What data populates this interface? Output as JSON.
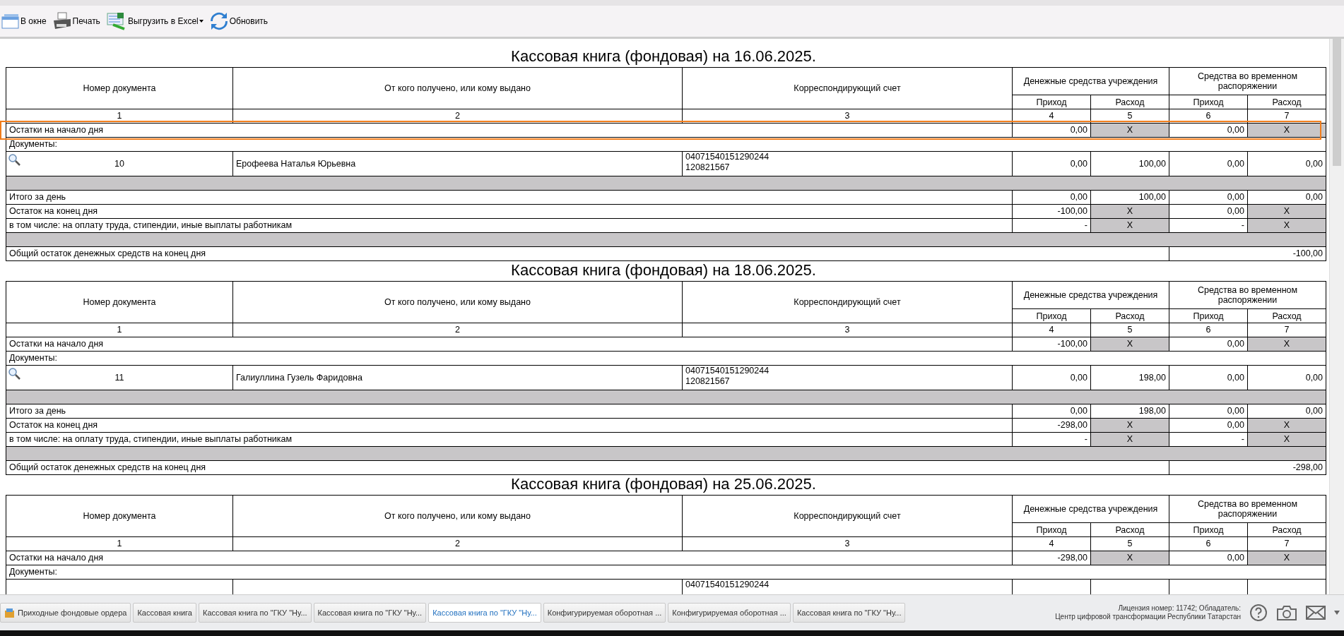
{
  "toolbar": {
    "buttons": [
      {
        "kind": "window",
        "label": "В окне"
      },
      {
        "kind": "print",
        "label": "Печать"
      },
      {
        "kind": "excel",
        "label": "Выгрузить в Excel",
        "dropdown": true
      },
      {
        "kind": "refresh",
        "label": "Обновить"
      }
    ]
  },
  "books": [
    {
      "title": "Кассовая книга (фондовая) на 16.06.2025.",
      "header": {
        "doc_number": "Номер документа",
        "counterparty": "От кого получено, или кому выдано",
        "account": "Корреспондирующий счет",
        "group_1": "Денежные средства учреждения",
        "group_2": "Средства во временном распоряжении",
        "income": "Приход",
        "expense": "Расход",
        "income_2": "Приход",
        "expense_2": "Расход",
        "column_numbers": [
          "1",
          "2",
          "3",
          "4",
          "5",
          "6",
          "7"
        ]
      },
      "opening": {
        "label": "Остатки на начало дня",
        "highlighted": true,
        "cells": [
          {
            "text": "0,00",
            "blocked": false
          },
          {
            "text": "X",
            "blocked": true
          },
          {
            "text": "0,00",
            "blocked": false
          },
          {
            "text": "X",
            "blocked": true
          }
        ]
      },
      "documents_label": "Документы:",
      "documents": [
        {
          "number": "10",
          "name": "Ерофеева Наталья Юрьевна",
          "account": [
            "04071540151290244",
            "120821567"
          ],
          "cells": [
            "0,00",
            "100,00",
            "0,00",
            "0,00"
          ]
        }
      ],
      "summary": [
        {
          "label": "Итого за день",
          "cells": [
            {
              "text": "0,00",
              "blocked": false
            },
            {
              "text": "100,00",
              "blocked": false
            },
            {
              "text": "0,00",
              "blocked": false
            },
            {
              "text": "0,00",
              "blocked": false
            }
          ]
        },
        {
          "label": "Остаток на конец дня",
          "cells": [
            {
              "text": "-100,00",
              "blocked": false
            },
            {
              "text": "X",
              "blocked": true
            },
            {
              "text": "0,00",
              "blocked": false
            },
            {
              "text": "X",
              "blocked": true
            }
          ]
        },
        {
          "label": "в том числе: на оплату труда, стипендии, иные выплаты работникам",
          "cells": [
            {
              "text": "-",
              "blocked": false
            },
            {
              "text": "X",
              "blocked": true
            },
            {
              "text": "-",
              "blocked": false
            },
            {
              "text": "X",
              "blocked": true
            }
          ]
        }
      ],
      "total": {
        "label": "Общий остаток денежных средств на конец дня",
        "value": "-100,00"
      }
    },
    {
      "title": "Кассовая книга (фондовая) на 18.06.2025.",
      "header": {
        "doc_number": "Номер документа",
        "counterparty": "От кого получено, или кому выдано",
        "account": "Корреспондирующий счет",
        "group_1": "Денежные средства учреждения",
        "group_2": "Средства во временном распоряжении",
        "income": "Приход",
        "expense": "Расход",
        "income_2": "Приход",
        "expense_2": "Расход",
        "column_numbers": [
          "1",
          "2",
          "3",
          "4",
          "5",
          "6",
          "7"
        ]
      },
      "opening": {
        "label": "Остатки на начало дня",
        "highlighted": false,
        "cells": [
          {
            "text": "-100,00",
            "blocked": false
          },
          {
            "text": "X",
            "blocked": true
          },
          {
            "text": "0,00",
            "blocked": false
          },
          {
            "text": "X",
            "blocked": true
          }
        ]
      },
      "documents_label": "Документы:",
      "documents": [
        {
          "number": "11",
          "name": "Галиуллина Гузель Фаридовна",
          "account": [
            "04071540151290244",
            "120821567"
          ],
          "cells": [
            "0,00",
            "198,00",
            "0,00",
            "0,00"
          ]
        }
      ],
      "summary": [
        {
          "label": "Итого за день",
          "cells": [
            {
              "text": "0,00",
              "blocked": false
            },
            {
              "text": "198,00",
              "blocked": false
            },
            {
              "text": "0,00",
              "blocked": false
            },
            {
              "text": "0,00",
              "blocked": false
            }
          ]
        },
        {
          "label": "Остаток на конец дня",
          "cells": [
            {
              "text": "-298,00",
              "blocked": false
            },
            {
              "text": "X",
              "blocked": true
            },
            {
              "text": "0,00",
              "blocked": false
            },
            {
              "text": "X",
              "blocked": true
            }
          ]
        },
        {
          "label": "в том числе: на оплату труда, стипендии, иные выплаты работникам",
          "cells": [
            {
              "text": "-",
              "blocked": false
            },
            {
              "text": "X",
              "blocked": true
            },
            {
              "text": "-",
              "blocked": false
            },
            {
              "text": "X",
              "blocked": true
            }
          ]
        }
      ],
      "total": {
        "label": "Общий остаток денежных средств на конец дня",
        "value": "-298,00"
      }
    },
    {
      "title": "Кассовая книга (фондовая) на 25.06.2025.",
      "header": {
        "doc_number": "Номер документа",
        "counterparty": "От кого получено, или кому выдано",
        "account": "Корреспондирующий счет",
        "group_1": "Денежные средства учреждения",
        "group_2": "Средства во временном распоряжении",
        "income": "Приход",
        "expense": "Расход",
        "income_2": "Приход",
        "expense_2": "Расход",
        "column_numbers": [
          "1",
          "2",
          "3",
          "4",
          "5",
          "6",
          "7"
        ]
      },
      "opening": {
        "label": "Остатки на начало дня",
        "highlighted": false,
        "cells": [
          {
            "text": "-298,00",
            "blocked": false
          },
          {
            "text": "X",
            "blocked": true
          },
          {
            "text": "0,00",
            "blocked": false
          },
          {
            "text": "X",
            "blocked": true
          }
        ]
      },
      "documents_label": "Документы:",
      "documents": [
        {
          "account": [
            "04071540151290244"
          ]
        }
      ]
    }
  ],
  "taskbar": {
    "tabs": [
      {
        "label": "Приходные фондовые ордера",
        "icon": true,
        "selected": false
      },
      {
        "label": "Кассовая книга",
        "icon": false,
        "selected": false
      },
      {
        "label": "Кассовая книга по \"ГКУ \"Ну...",
        "icon": false,
        "selected": false
      },
      {
        "label": "Кассовая книга по \"ГКУ \"Ну...",
        "icon": false,
        "selected": false
      },
      {
        "label": "Кассовая книга по \"ГКУ \"Ну...",
        "icon": false,
        "selected": true
      },
      {
        "label": "Конфигурируемая оборотная ...",
        "icon": false,
        "selected": false
      },
      {
        "label": "Конфигурируемая оборотная ...",
        "icon": false,
        "selected": false
      },
      {
        "label": "Кассовая книга по \"ГКУ \"Ну...",
        "icon": false,
        "selected": false
      }
    ],
    "license": [
      "Лицензия номер: 11742; Обладатель:",
      "Центр цифровой трансформации Республики Татарстан"
    ]
  }
}
